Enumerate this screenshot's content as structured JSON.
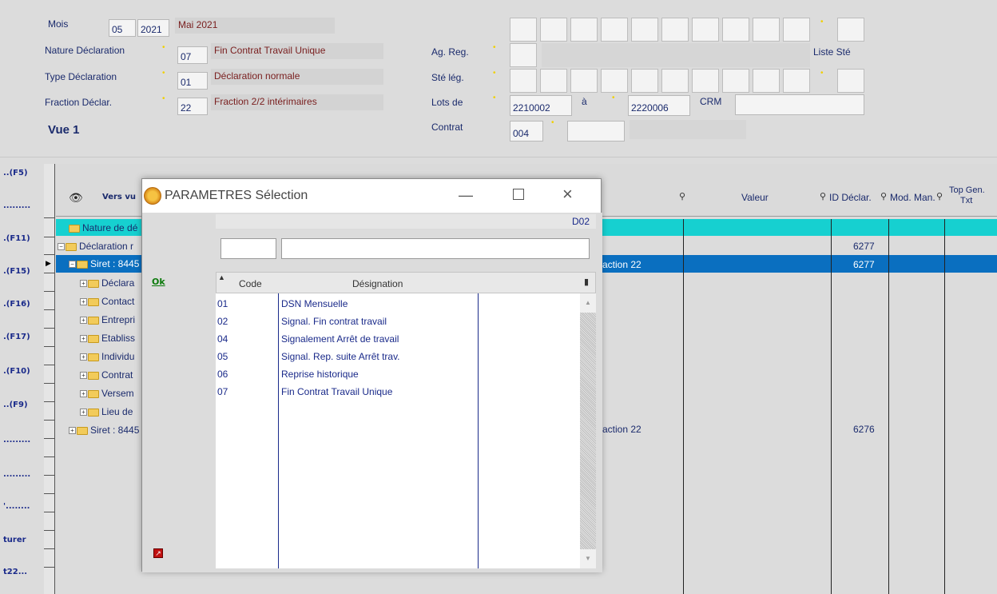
{
  "header": {
    "mois_label": "Mois",
    "mois_value": "05",
    "annee_value": "2021",
    "mois_text": "Mai 2021",
    "nature_label": "Nature Déclaration",
    "nature_code": "07",
    "nature_text": "Fin Contrat Travail Unique",
    "type_label": "Type Déclaration",
    "type_code": "01",
    "type_text": "Déclaration normale",
    "fraction_label": "Fraction Déclar.",
    "fraction_code": "22",
    "fraction_text": "Fraction 2/2 intérimaires",
    "vue_label": "Vue 1",
    "agreg_label": "Ag. Reg.",
    "liste_ste_label": "Liste Sté",
    "ste_leg_label": "Sté lég.",
    "lots_label": "Lots de",
    "lots_from": "2210002",
    "lots_a": "à",
    "lots_to": "2220006",
    "crm_label": "CRM",
    "contrat_label": "Contrat",
    "contrat_value": "004"
  },
  "fkeys": [
    "..(F5)",
    ".........",
    ".(F11)",
    ".(F15)",
    ".(F16)",
    ".(F17)",
    ".(F10)",
    "..(F9)",
    ".........",
    ".........",
    "'........",
    "turer",
    "t22..."
  ],
  "grid": {
    "col_header_vers": "Vers vu",
    "col_valeur": "Valeur",
    "col_id_declar": "ID Déclar.",
    "col_mod_man": "Mod. Man.",
    "col_top_gen": "Top Gen.",
    "col_top_gen2": "Txt",
    "rows": [
      {
        "text": "Nature de dé",
        "mid": "",
        "id": ""
      },
      {
        "text": "Déclaration r",
        "mid": "",
        "id": "6277"
      },
      {
        "text": "Siret : 8445",
        "mid": "action 22",
        "id": "6277"
      },
      {
        "text": "Déclara",
        "mid": "",
        "id": ""
      },
      {
        "text": "Contact",
        "mid": "",
        "id": ""
      },
      {
        "text": "Entrepri",
        "mid": "",
        "id": ""
      },
      {
        "text": "Etabliss",
        "mid": "",
        "id": ""
      },
      {
        "text": "Individu",
        "mid": "",
        "id": ""
      },
      {
        "text": "Contrat",
        "mid": "",
        "id": ""
      },
      {
        "text": "Versem",
        "mid": "",
        "id": ""
      },
      {
        "text": "Lieu de",
        "mid": "",
        "id": ""
      },
      {
        "text": "Siret : 8445",
        "mid": "action 22",
        "id": "6276"
      }
    ]
  },
  "modal": {
    "title": "PARAMETRES Sélection",
    "badge": "D02",
    "ok_label": "Ok",
    "code_header": "Code",
    "designation_header": "Désignation",
    "items": [
      {
        "code": "01",
        "designation": "DSN Mensuelle"
      },
      {
        "code": "02",
        "designation": "Signal. Fin contrat travail"
      },
      {
        "code": "04",
        "designation": "Signalement Arrêt de travail"
      },
      {
        "code": "05",
        "designation": "Signal. Rep. suite Arrêt trav."
      },
      {
        "code": "06",
        "designation": "Reprise historique"
      },
      {
        "code": "07",
        "designation": "Fin Contrat Travail Unique"
      }
    ]
  }
}
